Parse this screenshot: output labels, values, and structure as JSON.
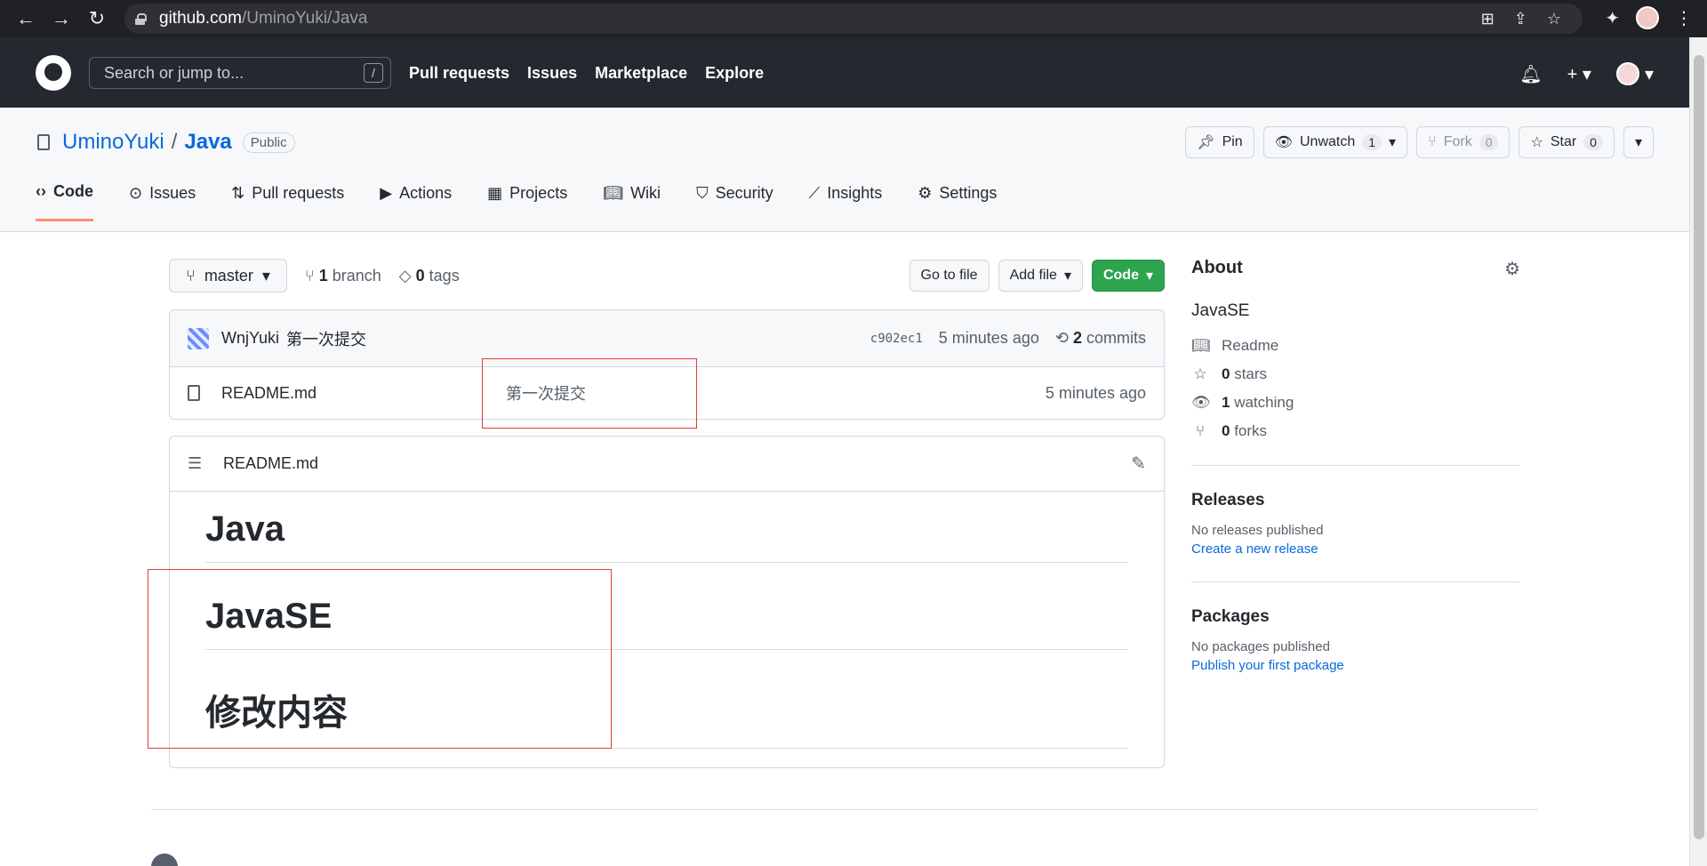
{
  "browser": {
    "url_host": "github.com",
    "url_path": "/UminoYuki/Java"
  },
  "header": {
    "search_placeholder": "Search or jump to...",
    "slash_hint": "/",
    "nav": [
      "Pull requests",
      "Issues",
      "Marketplace",
      "Explore"
    ]
  },
  "repo": {
    "owner": "UminoYuki",
    "separator": "/",
    "name": "Java",
    "visibility": "Public",
    "actions": {
      "pin": "Pin",
      "unwatch": "Unwatch",
      "watch_count": "1",
      "fork": "Fork",
      "fork_count": "0",
      "star": "Star",
      "star_count": "0"
    },
    "tabs": [
      "Code",
      "Issues",
      "Pull requests",
      "Actions",
      "Projects",
      "Wiki",
      "Security",
      "Insights",
      "Settings"
    ]
  },
  "toolbar": {
    "branch": "master",
    "branch_count": "1",
    "branch_label": "branch",
    "tag_count": "0",
    "tag_label": "tags",
    "go_to_file": "Go to file",
    "add_file": "Add file",
    "code": "Code"
  },
  "commit": {
    "author": "WnjYuki",
    "message": "第一次提交",
    "sha": "c902ec1",
    "time": "5 minutes ago",
    "commit_count": "2",
    "commit_label": "commits"
  },
  "files": [
    {
      "name": "README.md",
      "message": "第一次提交",
      "age": "5 minutes ago"
    }
  ],
  "readme": {
    "title": "README.md",
    "headings": [
      "Java",
      "JavaSE",
      "修改内容"
    ]
  },
  "sidebar": {
    "about_title": "About",
    "description": "JavaSE",
    "readme": "Readme",
    "stars_count": "0",
    "stars_label": "stars",
    "watching_count": "1",
    "watching_label": "watching",
    "forks_count": "0",
    "forks_label": "forks",
    "releases_title": "Releases",
    "releases_note": "No releases published",
    "releases_link": "Create a new release",
    "packages_title": "Packages",
    "packages_note": "No packages published",
    "packages_link": "Publish your first package"
  }
}
